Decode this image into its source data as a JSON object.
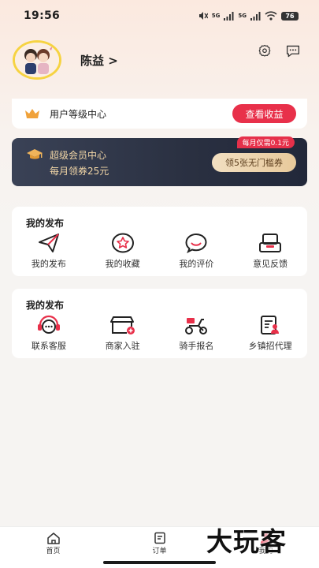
{
  "status_bar": {
    "time": "19:56",
    "network": "5G",
    "network2": "5G",
    "battery": "76"
  },
  "profile": {
    "name": "陈益 >"
  },
  "icons": {
    "settings": "gear-icon",
    "message": "chat-bubble-icon",
    "crown": "crown-icon",
    "graduation_cap": "graduation-cap-icon"
  },
  "level_card": {
    "label": "用户等级中心",
    "button": "查看收益"
  },
  "vip_card": {
    "title": "超级会员中心",
    "subtitle": "每月领券25元",
    "badge": "每月仅需0.1元",
    "button": "领5张无门槛券"
  },
  "section1": {
    "title": "我的发布",
    "items": [
      {
        "label": "我的发布",
        "icon": "paper-plane-icon"
      },
      {
        "label": "我的收藏",
        "icon": "star-icon"
      },
      {
        "label": "我的评价",
        "icon": "smile-chat-icon"
      },
      {
        "label": "意见反馈",
        "icon": "feedback-box-icon"
      }
    ]
  },
  "section2": {
    "title": "我的发布",
    "items": [
      {
        "label": "联系客服",
        "icon": "headset-icon"
      },
      {
        "label": "商家入驻",
        "icon": "store-icon"
      },
      {
        "label": "骑手报名",
        "icon": "scooter-icon"
      },
      {
        "label": "乡镇招代理",
        "icon": "agent-form-icon"
      }
    ]
  },
  "tab_bar": {
    "tabs": [
      {
        "label": "首页",
        "icon": "home-icon"
      },
      {
        "label": "订单",
        "icon": "order-icon"
      },
      {
        "label": "我的",
        "icon": "profile-icon"
      }
    ]
  },
  "watermark": "大玩客",
  "colors": {
    "accent": "#e8304a",
    "gold": "#f3d7a7",
    "vip_bg": "#2a3041"
  }
}
